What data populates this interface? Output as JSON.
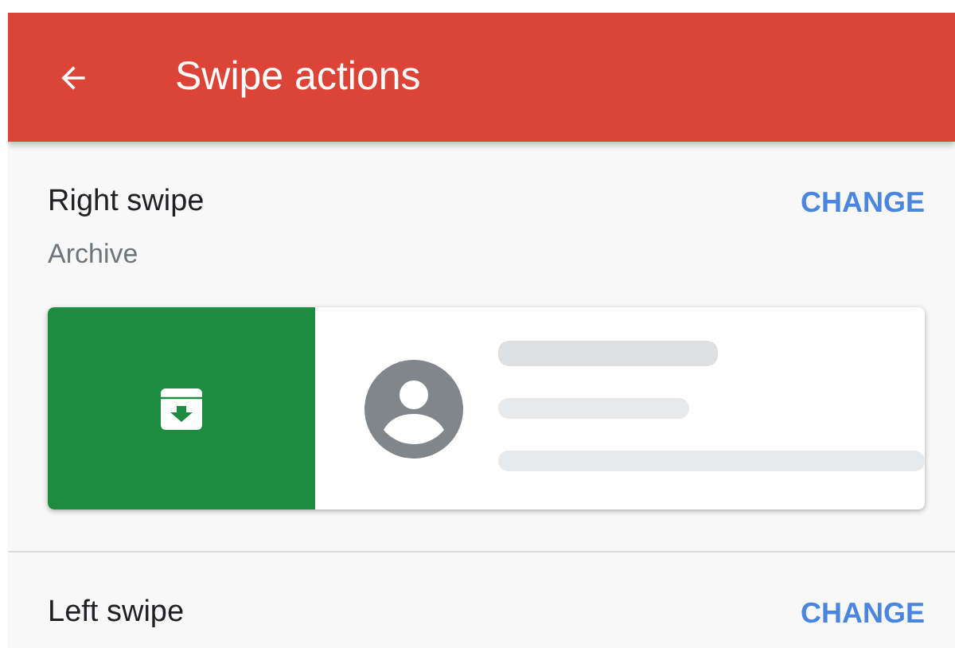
{
  "app_bar": {
    "title": "Swipe actions"
  },
  "sections": [
    {
      "title": "Right swipe",
      "button": "CHANGE",
      "action": "Archive",
      "preview": {
        "kind": "archive",
        "color": "#1e8c40"
      }
    },
    {
      "title": "Left swipe",
      "button": "CHANGE"
    }
  ]
}
